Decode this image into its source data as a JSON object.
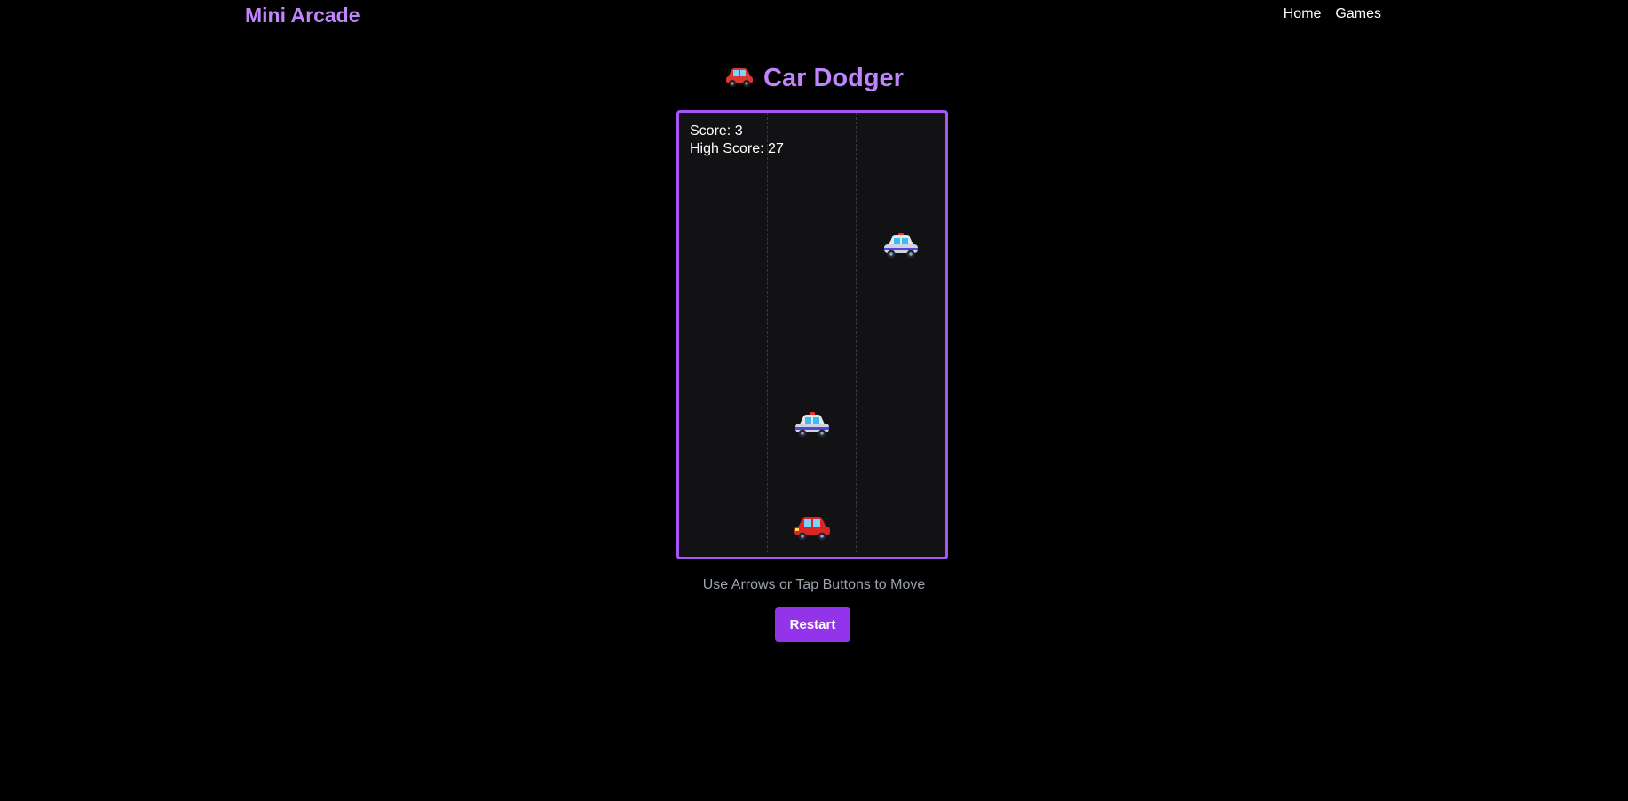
{
  "nav": {
    "brand": "Mini Arcade",
    "links": [
      "Home",
      "Games"
    ]
  },
  "game": {
    "title": "Car Dodger",
    "title_icon": "red-car-icon",
    "score_label": "Score: 3",
    "high_score_label": "High Score: 27",
    "score": 3,
    "high_score": 27,
    "lanes": 3,
    "hint": "Use Arrows or Tap Buttons to Move",
    "restart_label": "Restart"
  },
  "colors": {
    "accent": "#c084fc",
    "border": "#a855f7",
    "button": "#9333ea",
    "board_bg": "#121214",
    "page_bg": "#000000"
  }
}
